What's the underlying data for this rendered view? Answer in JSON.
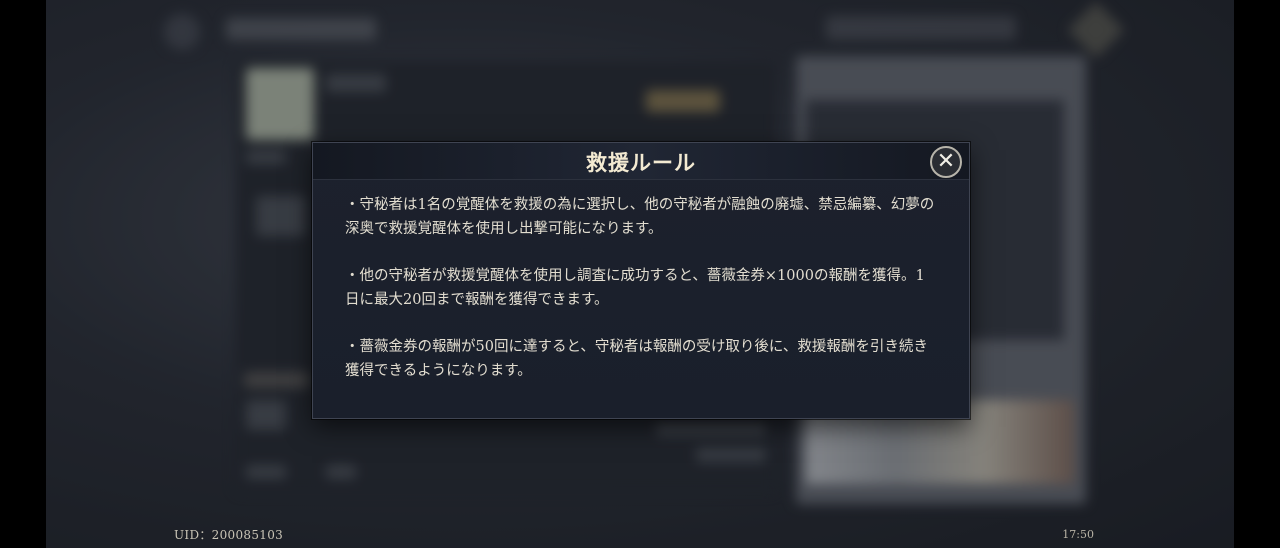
{
  "dialog": {
    "title": "救援ルール",
    "close_icon": "close-icon",
    "paragraphs": [
      "・守秘者は1名の覚醒体を救援の為に選択し、他の守秘者が融蝕の廃墟、禁忌編纂、幻夢の深奥で救援覚醒体を使用し出撃可能になります。",
      "・他の守秘者が救援覚醒体を使用し調査に成功すると、薔薇金券×1000の報酬を獲得。1日に最大20回まで報酬を獲得できます。",
      "・薔薇金券の報酬が50回に達すると、守秘者は報酬の受け取り後に、救援報酬を引き続き獲得できるようになります。"
    ]
  },
  "footer": {
    "uid": "UID：200085103",
    "time": "17:50"
  }
}
